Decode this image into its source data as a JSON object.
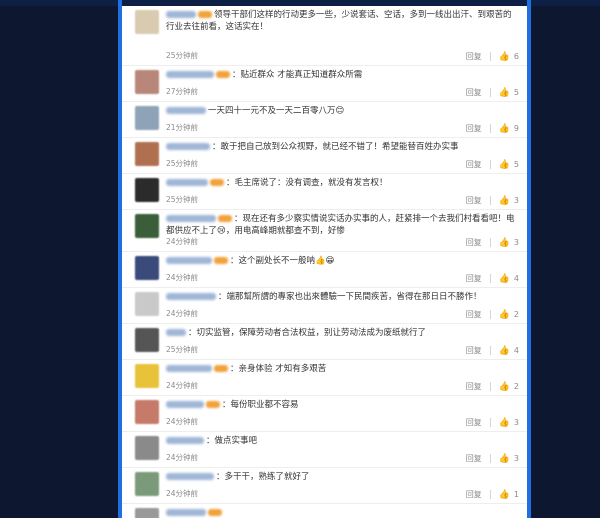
{
  "comments": [
    {
      "text": "领导干部们这样的行动更多一些，少说套话、空话，多到一线出出汗、到艰苦的行业去往前看，这话实在！",
      "time": "25分钟前",
      "reply": "回复",
      "likes": "6",
      "avatar_color": "#d9cbb0"
    },
    {
      "text": "：贴近群众 才能真正知道群众所需",
      "time": "27分钟前",
      "reply": "回复",
      "likes": "5",
      "avatar_color": "#b9867a"
    },
    {
      "text": "一天四十一元不及一天二百零八万😊",
      "time": "21分钟前",
      "reply": "回复",
      "likes": "9",
      "avatar_color": "#8fa3b8"
    },
    {
      "text": "：敢于把自己放到公众视野，就已经不错了！希望能替百姓办实事",
      "time": "25分钟前",
      "reply": "回复",
      "likes": "5",
      "avatar_color": "#b07050"
    },
    {
      "text": "：毛主席说了：没有调查，就没有发言权！",
      "time": "25分钟前",
      "reply": "回复",
      "likes": "3",
      "avatar_color": "#2b2b2b"
    },
    {
      "text": "：现在还有多少察实情说实话办实事的人，赶紧排一个去我们村看看吧！电都供应不上了😢，用电高峰期就都查不到，好惨",
      "time": "24分钟前",
      "reply": "回复",
      "likes": "3",
      "avatar_color": "#3a5d3a"
    },
    {
      "text": "：这个副处长不一般呐👍😁",
      "time": "24分钟前",
      "reply": "回复",
      "likes": "4",
      "avatar_color": "#3a4a7a"
    },
    {
      "text": "：端那幫所謂的專家也出來體驗一下民間疾苦，省得在那日日不勝作！",
      "time": "24分钟前",
      "reply": "回复",
      "likes": "2",
      "avatar_color": "#c9c9c9"
    },
    {
      "text": "：切实监管，保障劳动者合法权益，别让劳动法成为废纸就行了",
      "time": "25分钟前",
      "reply": "回复",
      "likes": "4",
      "avatar_color": "#555555"
    },
    {
      "text": "：亲身体验 才知有多艰苦",
      "time": "24分钟前",
      "reply": "回复",
      "likes": "2",
      "avatar_color": "#e8c33a"
    },
    {
      "text": "：每份职业都不容易",
      "time": "24分钟前",
      "reply": "回复",
      "likes": "3",
      "avatar_color": "#c57a6a"
    },
    {
      "text": "：做点实事吧",
      "time": "24分钟前",
      "reply": "回复",
      "likes": "3",
      "avatar_color": "#8a8a8a"
    },
    {
      "text": "：多干干，熟练了就好了",
      "time": "24分钟前",
      "reply": "回复",
      "likes": "1",
      "avatar_color": "#7a9a7a"
    },
    {
      "text": "",
      "time": "",
      "reply": "",
      "likes": "",
      "avatar_color": "#999999"
    }
  ]
}
